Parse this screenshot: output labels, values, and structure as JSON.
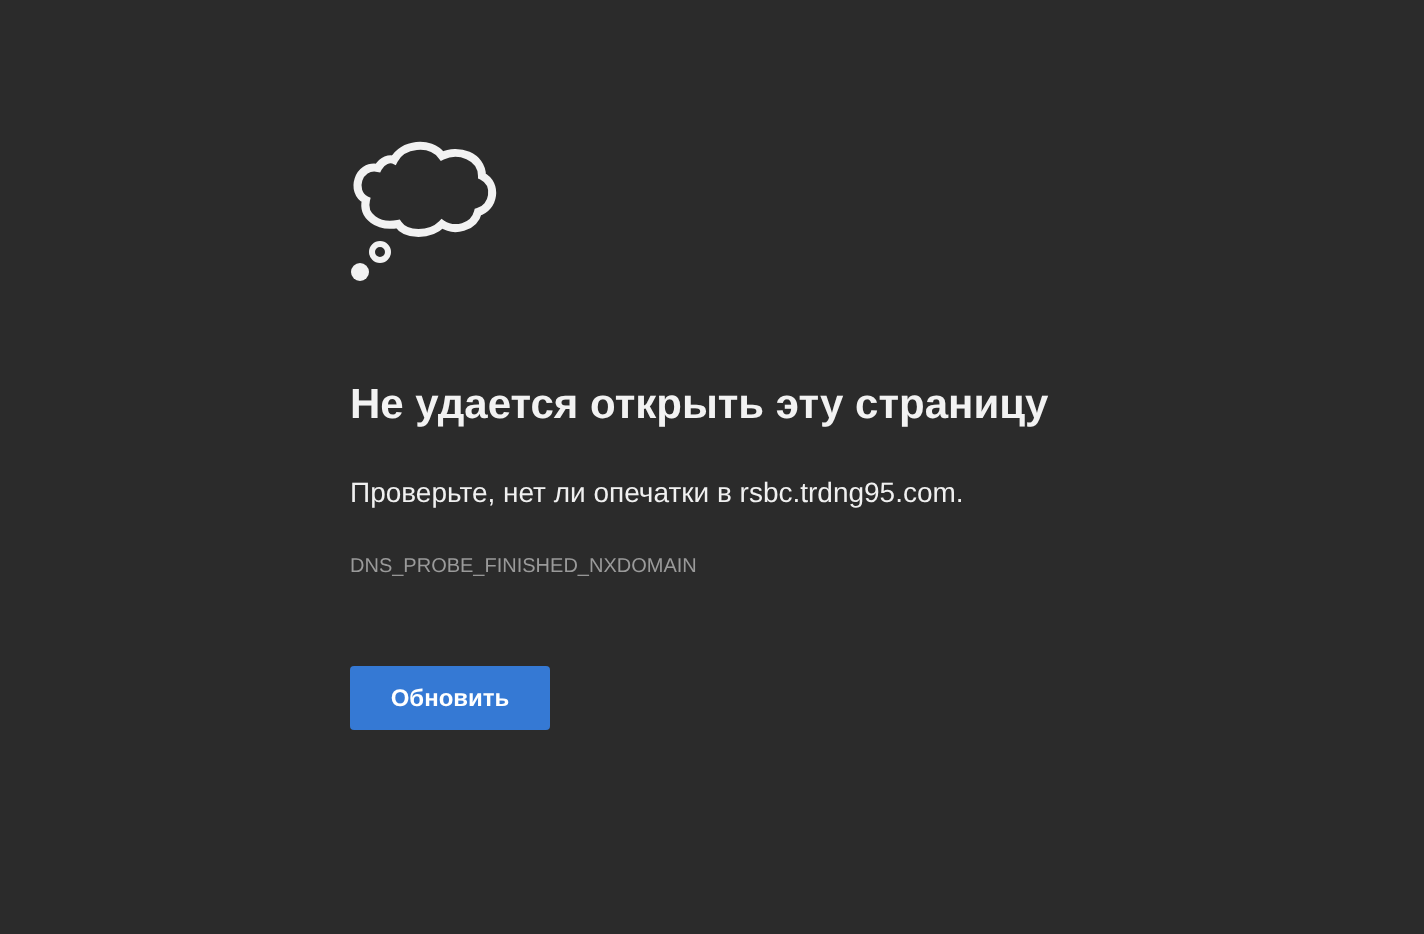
{
  "title": "Не удается открыть эту страницу",
  "message": "Проверьте, нет ли опечатки в rsbc.trdng95.com.",
  "error_code": "DNS_PROBE_FINISHED_NXDOMAIN",
  "button": "Обновить"
}
